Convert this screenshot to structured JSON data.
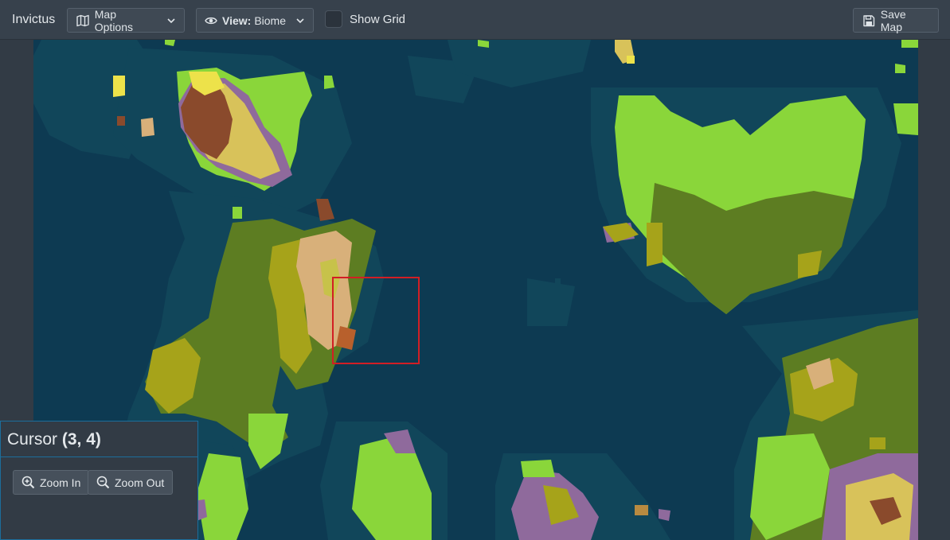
{
  "app": {
    "title": "Invictus"
  },
  "toolbar": {
    "map_options_label": "Map Options",
    "view_prefix": "View:",
    "view_value": "Biome",
    "show_grid_label": "Show Grid",
    "show_grid_checked": false,
    "save_label": "Save Map"
  },
  "cursor_panel": {
    "title_prefix": "Cursor",
    "coords": "(3, 4)",
    "zoom_in_label": "Zoom In",
    "zoom_out_label": "Zoom Out"
  },
  "map": {
    "biome_colors": {
      "deep_ocean": "#0d3a52",
      "shallow_ocean": "#11465a",
      "grassland": "#8ad63a",
      "forest": "#5d7d22",
      "savanna": "#a6a31a",
      "desert": "#d8b07a",
      "mountain": "#8a4a2c",
      "tundra": "#8f6a9c",
      "beach": "#ede24a",
      "hills": "#b88a40"
    }
  }
}
